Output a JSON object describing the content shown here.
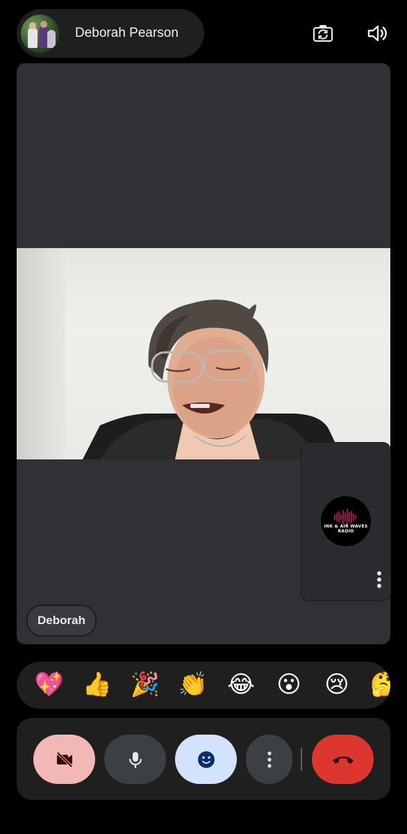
{
  "header": {
    "caller_name": "Deborah Pearson",
    "avatar_icon": "profile-photo",
    "actions": [
      {
        "name": "switch-camera",
        "icon": "camera-flip-icon"
      },
      {
        "name": "speaker",
        "icon": "volume-icon"
      }
    ]
  },
  "main_tile": {
    "participant_label": "Deborah",
    "tile_color": "#303134"
  },
  "self_view": {
    "logo_text": "INK & AIR WAVES RADIO",
    "logo_accent": "#c2185b",
    "more_icon": "more-vert-icon"
  },
  "reactions": [
    {
      "name": "sparkling-heart",
      "glyph": "💖"
    },
    {
      "name": "thumbs-up",
      "glyph": "👍"
    },
    {
      "name": "party-popper",
      "glyph": "🎉"
    },
    {
      "name": "clapping-hands",
      "glyph": "👏"
    },
    {
      "name": "tears-of-joy",
      "glyph": "😂"
    },
    {
      "name": "surprised",
      "glyph": "😮"
    },
    {
      "name": "crying",
      "glyph": "😢"
    },
    {
      "name": "thinking",
      "glyph": "🤔"
    }
  ],
  "controls": {
    "camera": {
      "state": "off",
      "bg": "#f2b8b5",
      "icon": "videocam-off-icon"
    },
    "mic": {
      "state": "on",
      "bg": "#3c4043",
      "icon": "mic-icon"
    },
    "reactions": {
      "state": "active",
      "bg": "#d3e3fd",
      "icon": "emoji-icon"
    },
    "more": {
      "bg": "#3c4043",
      "icon": "more-vert-icon"
    },
    "end_call": {
      "bg": "#dc362e",
      "icon": "call-end-icon"
    }
  }
}
